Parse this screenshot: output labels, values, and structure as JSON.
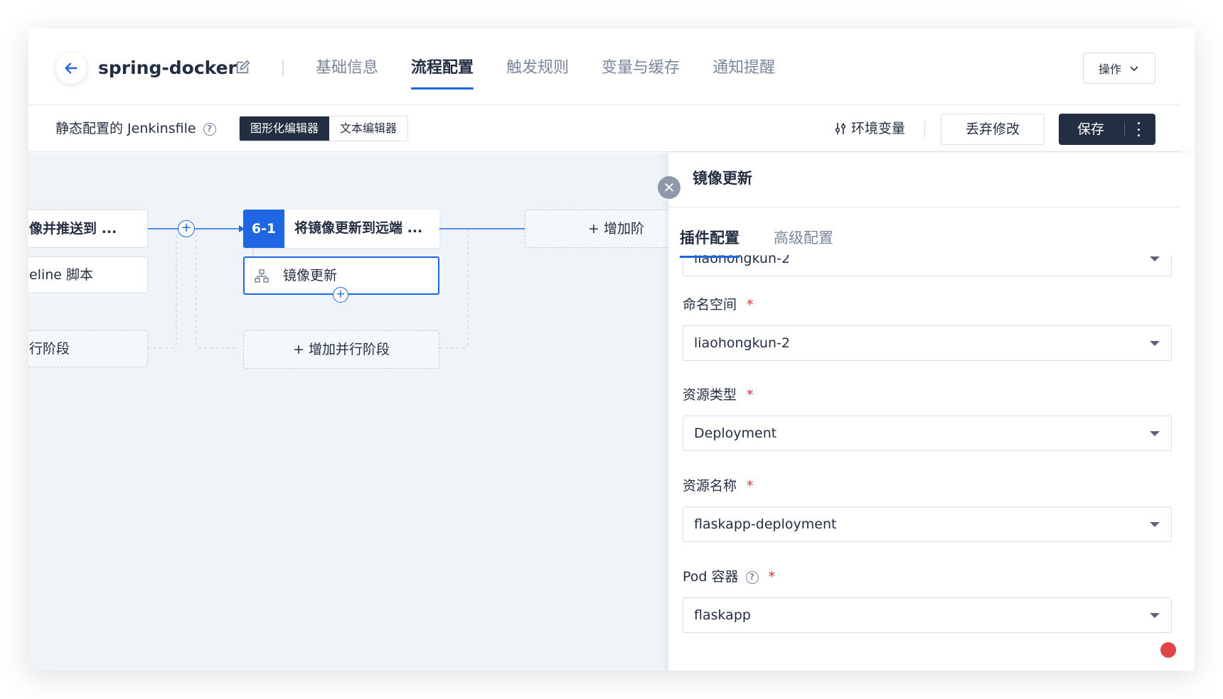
{
  "header": {
    "project_name": "spring-docker",
    "tabs": [
      {
        "label": "基础信息"
      },
      {
        "label": "流程配置"
      },
      {
        "label": "触发规则"
      },
      {
        "label": "变量与缓存"
      },
      {
        "label": "通知提醒"
      }
    ],
    "ops_label": "操作"
  },
  "toolbar": {
    "jenkins_label": "静态配置的 Jenkinsfile",
    "help_glyph": "?",
    "editor_graphical": "图形化编辑器",
    "editor_text": "文本编辑器",
    "env_var_label": "环境变量",
    "discard_label": "丢弃修改",
    "save_label": "保存"
  },
  "canvas": {
    "prev_stage_title": "像并推送到 ...",
    "prev_step_label": "eline 脚本",
    "prev_parallel_label": "行阶段",
    "stage_badge": "6-1",
    "stage_title": "将镜像更新到远端 ...",
    "step_label": "镜像更新",
    "add_parallel_label": "+ 增加并行阶段",
    "add_stage_label": "+ 增加阶"
  },
  "drawer": {
    "title": "镜像更新",
    "tabs": [
      {
        "label": "插件配置"
      },
      {
        "label": "高级配置"
      }
    ],
    "fields": {
      "cluster_value": "liaohongkun-2",
      "namespace_label": "命名空间",
      "namespace_value": "liaohongkun-2",
      "resource_type_label": "资源类型",
      "resource_type_value": "Deployment",
      "resource_name_label": "资源名称",
      "resource_name_value": "flaskapp-deployment",
      "pod_container_label": "Pod 容器",
      "pod_container_value": "flaskapp",
      "required_mark": "*"
    }
  },
  "colors": {
    "accent": "#1f66e3",
    "dark": "#242e42",
    "canvas_bg": "#eff4f9",
    "required": "#e02c3a"
  }
}
